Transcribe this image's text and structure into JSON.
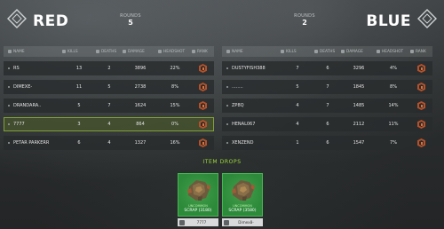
{
  "header": {
    "left": {
      "team": "RED",
      "rounds_label": "ROUNDS",
      "rounds": "5"
    },
    "right": {
      "team": "BLUE",
      "rounds_label": "ROUNDS",
      "rounds": "2"
    }
  },
  "columns": {
    "name": "NAME",
    "kills": "KILLS",
    "deaths": "DEATHS",
    "damage": "DAMAGE",
    "headshot": "HEADSHOT",
    "rank": "RANK"
  },
  "teams": {
    "red": [
      {
        "name": "RS",
        "kills": "13",
        "deaths": "2",
        "damage": "3896",
        "headshot": "22%"
      },
      {
        "name": "DIMEXE-",
        "kills": "11",
        "deaths": "5",
        "damage": "2738",
        "headshot": "8%"
      },
      {
        "name": "DRANDARA..",
        "kills": "5",
        "deaths": "7",
        "damage": "1624",
        "headshot": "15%"
      },
      {
        "name": "7777",
        "kills": "3",
        "deaths": "4",
        "damage": "864",
        "headshot": "0%"
      },
      {
        "name": "PETAR PARKERR",
        "kills": "6",
        "deaths": "4",
        "damage": "1327",
        "headshot": "16%"
      }
    ],
    "blue": [
      {
        "name": "DUSTYFISH388",
        "kills": "7",
        "deaths": "6",
        "damage": "3296",
        "headshot": "4%"
      },
      {
        "name": "........",
        "kills": "5",
        "deaths": "7",
        "damage": "1845",
        "headshot": "8%"
      },
      {
        "name": "ZP8Q",
        "kills": "4",
        "deaths": "7",
        "damage": "1485",
        "headshot": "14%"
      },
      {
        "name": "HENAL067",
        "kills": "4",
        "deaths": "6",
        "damage": "2112",
        "headshot": "11%"
      },
      {
        "name": "XENZEND",
        "kills": "1",
        "deaths": "6",
        "damage": "1547",
        "headshot": "7%"
      }
    ]
  },
  "item_drops": {
    "title": "ITEM DROPS",
    "items": [
      {
        "rarity": "UNCOMMON",
        "name": "SCRAP (3180)",
        "owner": "7777",
        "icon": "scrap-icon"
      },
      {
        "rarity": "UNCOMMON",
        "name": "SCRAP (3580)",
        "owner": "Dimex8-",
        "icon": "scrap-icon"
      }
    ]
  },
  "colors": {
    "accent_green": "#9fdc3a",
    "drop_card_green": "#2c8a3a",
    "rank_orange": "#b5512a",
    "highlight_row_border": "#96be3c"
  }
}
